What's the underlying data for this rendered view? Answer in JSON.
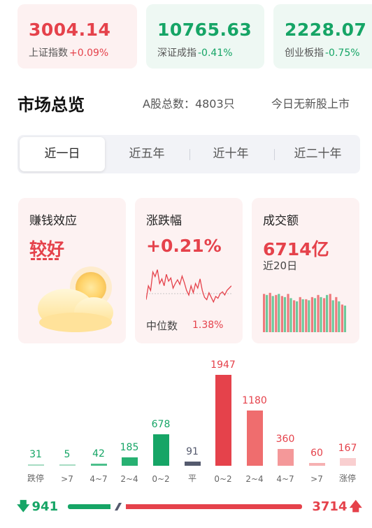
{
  "indices": [
    {
      "value": "3004.14",
      "name": "上证指数",
      "change": "+0.09%",
      "dir": "up"
    },
    {
      "value": "10765.63",
      "name": "深证成指",
      "change": "-0.41%",
      "dir": "down"
    },
    {
      "value": "2228.07",
      "name": "创业板指",
      "change": "-0.75%",
      "dir": "down"
    }
  ],
  "overview": {
    "title": "市场总览",
    "stock_count": "A股总数：4803只",
    "ipo_note": "今日无新股上市"
  },
  "tabs": [
    {
      "label": "近一日",
      "active": true
    },
    {
      "label": "近五年",
      "active": false
    },
    {
      "label": "近十年",
      "active": false
    },
    {
      "label": "近二十年",
      "active": false
    }
  ],
  "cards": {
    "money_effect": {
      "label": "赚钱效应",
      "value": "较好",
      "icon": "sun-cloud-icon"
    },
    "change": {
      "label": "涨跌幅",
      "value": "+0.21%",
      "median_label": "中位数",
      "median_value": "1.38%"
    },
    "turnover": {
      "label": "成交额",
      "value": "6714亿",
      "period": "近20日"
    }
  },
  "sparkline": [
    0.25,
    0.55,
    0.45,
    0.85,
    0.75,
    0.9,
    0.6,
    0.7,
    0.55,
    0.8,
    0.65,
    0.72,
    0.5,
    0.6,
    0.68,
    0.58,
    0.76,
    0.62,
    0.45,
    0.35,
    0.55,
    0.4,
    0.6,
    0.5,
    0.7,
    0.45,
    0.3,
    0.25,
    0.4,
    0.3,
    0.2,
    0.32,
    0.28,
    0.38,
    0.42,
    0.35,
    0.45,
    0.5,
    0.55
  ],
  "turnover_bars": [
    {
      "red": 0.72,
      "green": 0.7
    },
    {
      "red": 0.74,
      "green": 0.68
    },
    {
      "red": 0.7,
      "green": 0.72
    },
    {
      "red": 0.68,
      "green": 0.66
    },
    {
      "red": 0.72,
      "green": 0.64
    },
    {
      "red": 0.6,
      "green": 0.58
    },
    {
      "red": 0.66,
      "green": 0.62
    },
    {
      "red": 0.62,
      "green": 0.6
    },
    {
      "red": 0.66,
      "green": 0.64
    },
    {
      "red": 0.7,
      "green": 0.66
    },
    {
      "red": 0.64,
      "green": 0.7
    },
    {
      "red": 0.72,
      "green": 0.6
    },
    {
      "red": 0.66,
      "green": 0.58
    },
    {
      "red": 0.52,
      "green": 0.5
    }
  ],
  "chart_data": {
    "type": "bar",
    "categories": [
      "跌停",
      ">7",
      "4~7",
      "2~4",
      "0~2",
      "平",
      "0~2",
      "2~4",
      "4~7",
      ">7",
      "涨停"
    ],
    "values": [
      31,
      5,
      42,
      185,
      678,
      91,
      1947,
      1180,
      360,
      60,
      167
    ],
    "colors": [
      "#a6dcc3",
      "#a6dcc3",
      "#4bbf8b",
      "#27b172",
      "#16a566",
      "#555a6e",
      "#e5424b",
      "#ef6d6e",
      "#f49899",
      "#f6b1b2",
      "#f9cfd0"
    ],
    "value_colors": [
      "#16a566",
      "#16a566",
      "#16a566",
      "#16a566",
      "#16a566",
      "#555a6e",
      "#e5424b",
      "#e5424b",
      "#e5424b",
      "#e5424b",
      "#e5424b"
    ],
    "ylim": [
      0,
      1947
    ]
  },
  "totals": {
    "down": "941",
    "up": "3714"
  }
}
